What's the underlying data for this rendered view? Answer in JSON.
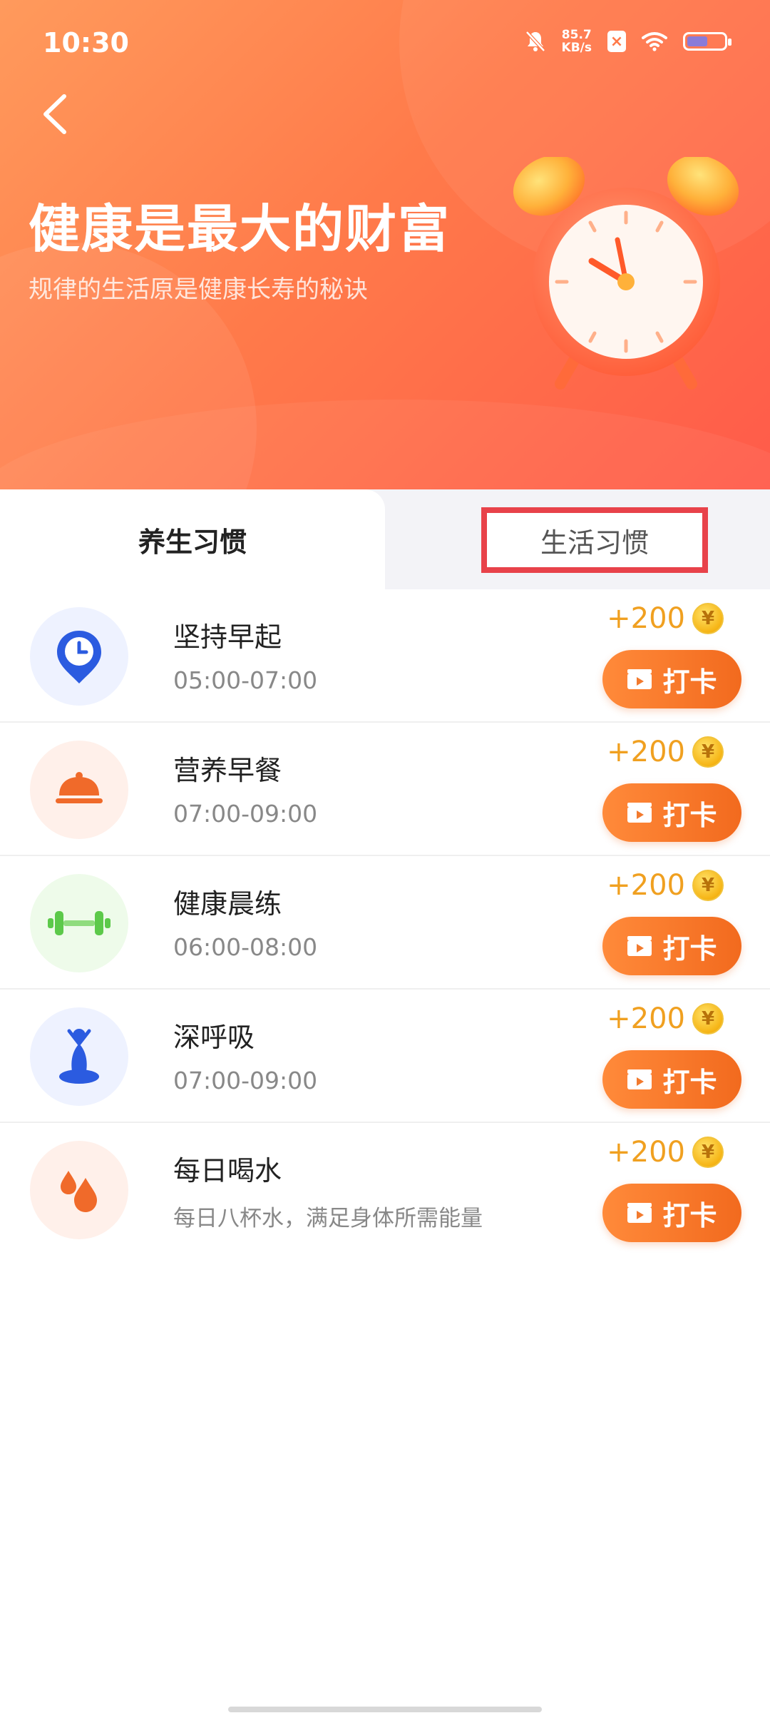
{
  "status_bar": {
    "time": "10:30",
    "net_speed_value": "85.7",
    "net_speed_unit": "KB/s",
    "icons": [
      "mute-bell-icon",
      "sim-off-icon",
      "wifi-icon",
      "battery-icon"
    ]
  },
  "header": {
    "back_icon": "chevron-left-icon",
    "title": "健康是最大的财富",
    "subtitle": "规律的生活原是健康长寿的秘诀"
  },
  "tabs": [
    {
      "label": "养生习惯",
      "active": true
    },
    {
      "label": "生活习惯",
      "active": false,
      "highlighted": true
    }
  ],
  "items": [
    {
      "title": "坚持早起",
      "subtitle": "05:00-07:00",
      "reward": "+200",
      "button": "打卡",
      "icon": "alarm-pin-icon",
      "bg": "#eef2ff"
    },
    {
      "title": "营养早餐",
      "subtitle": "07:00-09:00",
      "reward": "+200",
      "button": "打卡",
      "icon": "food-cloche-icon",
      "bg": "#fff0ea"
    },
    {
      "title": "健康晨练",
      "subtitle": "06:00-08:00",
      "reward": "+200",
      "button": "打卡",
      "icon": "dumbbell-icon",
      "bg": "#eefbea"
    },
    {
      "title": "深呼吸",
      "subtitle": "07:00-09:00",
      "reward": "+200",
      "button": "打卡",
      "icon": "meditation-icon",
      "bg": "#eef2ff"
    },
    {
      "title": "每日喝水",
      "subtitle": "每日八杯水，满足身体所需能量",
      "reward": "+200",
      "button": "打卡",
      "icon": "water-drops-icon",
      "bg": "#fff0ea"
    }
  ],
  "coin_symbol": "¥",
  "colors": {
    "hero_start": "#ff9a5c",
    "hero_end": "#ff5a4a",
    "accent": "#f26a1e",
    "reward": "#f0a020",
    "highlight_border": "#e8424a"
  }
}
